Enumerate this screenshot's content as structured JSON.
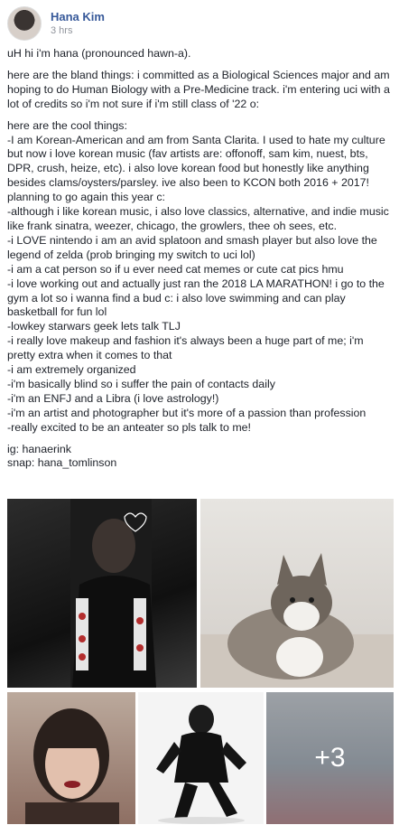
{
  "header": {
    "author": "Hana Kim",
    "time": "3 hrs",
    "privacy_icon": "globe-icon"
  },
  "post": {
    "paragraphs": [
      "uH hi i'm hana (pronounced hawn-a).",
      "here are the bland things: i committed as a Biological Sciences major and am hoping to do Human Biology with a Pre-Medicine track. i'm entering uci with a lot of credits so i'm not sure if i'm still class of '22 o:",
      "here are the cool things:\n-I am Korean-American and am from Santa Clarita. I used to hate my culture but now i love korean music (fav artists are: offonoff, sam kim, nuest, bts, DPR, crush, heize, etc). i also love korean food but honestly like anything besides clams/oysters/parsley. ive also been to KCON both 2016 + 2017! planning to go again this year c:\n-although i like korean music, i also love classics, alternative, and indie music like frank sinatra, weezer, chicago, the growlers, thee oh sees, etc.\n-i LOVE nintendo i am an avid splatoon and smash player but also love the legend of zelda (prob bringing my switch to uci lol)\n-i am a cat person so if u ever need cat memes or cute cat pics hmu\n-i love working out and actually just ran the 2018 LA MARATHON! i go to the gym a lot so i wanna find a bud c: i also love swimming and can play basketball for fun lol\n-lowkey starwars geek lets talk TLJ\n-i really love makeup and fashion it's always been a huge part of me; i'm pretty extra when it comes to that\n-i am extremely organized\n-i'm basically blind so i suffer the pain of contacts daily\n-i'm an ENFJ and a Libra (i love astrology!)\n-i'm an artist and photographer but it's more of a passion than profession\n-really excited to be an anteater so pls talk to me!",
      "ig: hanaerink\nsnap: hana_tomlinson"
    ]
  },
  "gallery": {
    "more_label": "+3"
  }
}
